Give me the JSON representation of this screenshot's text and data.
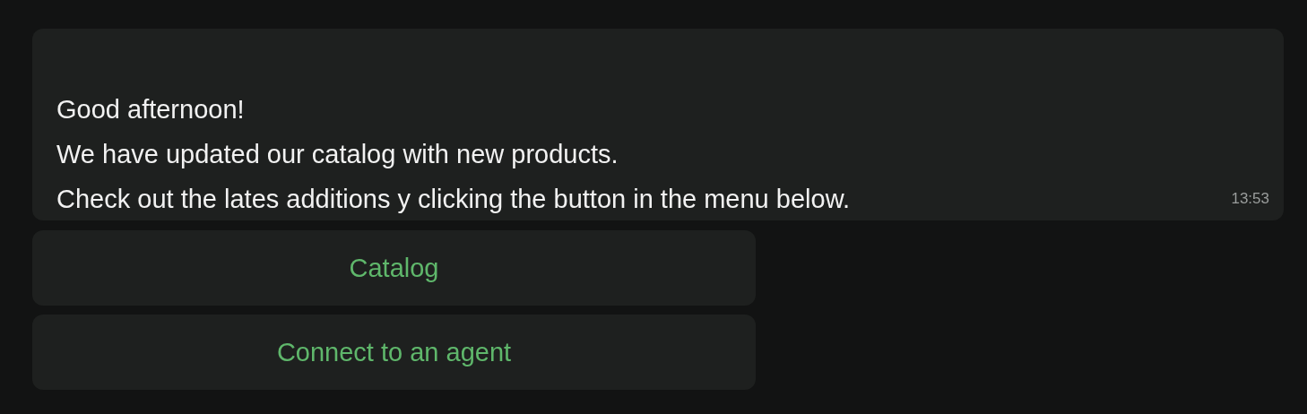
{
  "message": {
    "paragraphs": [
      "Good afternoon!",
      "We have updated our catalog with new products.",
      "Check out the lates additions y clicking the button in the menu below."
    ],
    "time": "13:53"
  },
  "buttons": [
    {
      "label": "Catalog"
    },
    {
      "label": "Connect to an agent"
    }
  ]
}
